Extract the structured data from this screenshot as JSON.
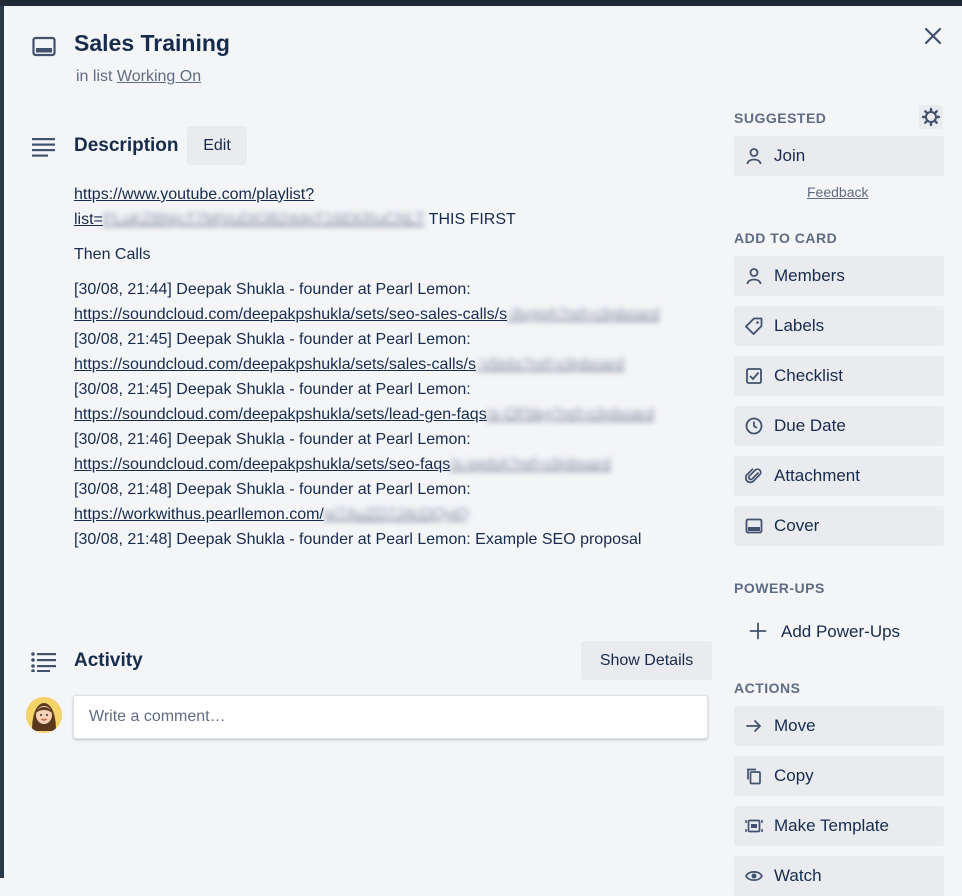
{
  "card": {
    "title": "Sales Training",
    "in_list_prefix": "in list",
    "list_name": "Working On"
  },
  "description": {
    "heading": "Description",
    "edit_label": "Edit",
    "playlist_url_line1": "https://www.youtube.com/playlist?",
    "playlist_url_line2_visible": "list=",
    "playlist_url_line2_blurred": "PLuKZBNjcT7MjVuDIOB24dpT16EKRuCNLT",
    "playlist_suffix": " THIS FIRST",
    "then_calls": "Then Calls",
    "entries": [
      {
        "meta": "[30/08, 21:44] Deepak Shukla - founder at Pearl Lemon:",
        "url_visible": "https://soundcloud.com/deepakpshukla/sets/seo-sales-calls/s",
        "url_blurred": "-8vgqA?ref=clipboard"
      },
      {
        "meta": "[30/08, 21:45] Deepak Shukla - founder at Pearl Lemon:",
        "url_visible": "https://soundcloud.com/deepakpshukla/sets/sales-calls/s",
        "url_blurred": "-Vbt4x?ref=clipboard"
      },
      {
        "meta": "[30/08, 21:45] Deepak Shukla - founder at Pearl Lemon:",
        "url_visible": "https://soundcloud.com/deepakpshukla/sets/lead-gen-faqs",
        "url_blurred": "/s-OFbkg?ref=clipboard"
      },
      {
        "meta": "[30/08, 21:46] Deepak Shukla - founder at Pearl Lemon:",
        "url_visible": "https://soundcloud.com/deepakpshukla/sets/seo-faqs",
        "url_blurred": "/s-iqebA?ref=clipboard"
      },
      {
        "meta": "[30/08, 21:48] Deepak Shukla - founder at Pearl Lemon:",
        "url_visible": "https://workwithus.pearllemon.com/",
        "url_blurred": "p/7AuZD7J4cDQyiQ"
      }
    ],
    "last_line": "[30/08, 21:48] Deepak Shukla - founder at Pearl Lemon: Example SEO proposal"
  },
  "activity": {
    "heading": "Activity",
    "show_details_label": "Show Details",
    "comment_placeholder": "Write a comment…"
  },
  "sidebar": {
    "suggested_label": "SUGGESTED",
    "join_label": "Join",
    "feedback_label": "Feedback",
    "add_to_card_label": "ADD TO CARD",
    "add_to_card": [
      {
        "label": "Members",
        "icon": "person-icon"
      },
      {
        "label": "Labels",
        "icon": "tag-icon"
      },
      {
        "label": "Checklist",
        "icon": "checkbox-icon"
      },
      {
        "label": "Due Date",
        "icon": "clock-icon"
      },
      {
        "label": "Attachment",
        "icon": "paperclip-icon"
      },
      {
        "label": "Cover",
        "icon": "cover-icon"
      }
    ],
    "powerups_label": "POWER-UPS",
    "add_powerups_label": "Add Power-Ups",
    "actions_label": "ACTIONS",
    "actions": [
      {
        "label": "Move",
        "icon": "arrow-right-icon"
      },
      {
        "label": "Copy",
        "icon": "copy-icon"
      },
      {
        "label": "Make Template",
        "icon": "template-icon"
      },
      {
        "label": "Watch",
        "icon": "eye-icon"
      }
    ]
  }
}
